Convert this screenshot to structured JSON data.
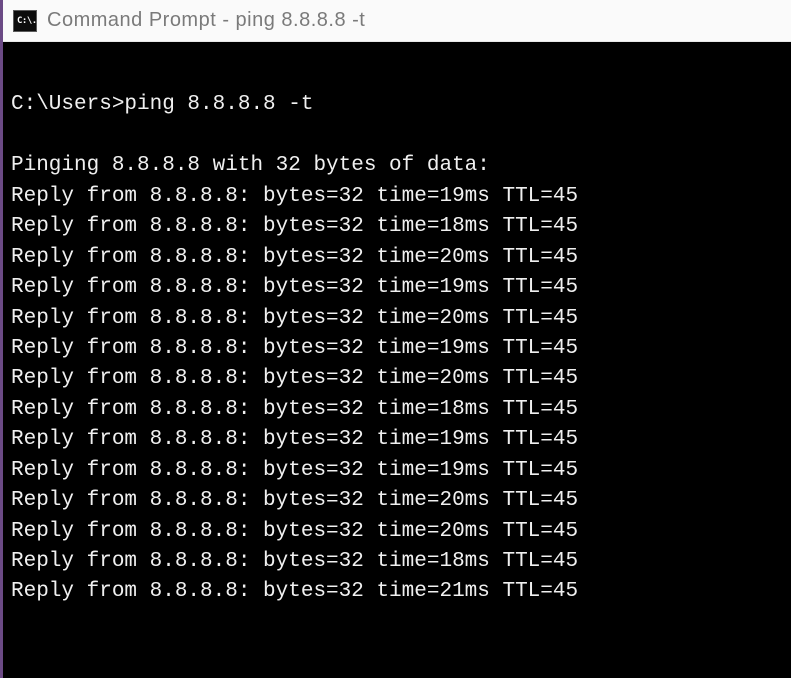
{
  "window": {
    "icon_label": "C:\\.",
    "title": "Command Prompt - ping  8.8.8.8 -t"
  },
  "terminal": {
    "prompt_line": "C:\\Users>ping 8.8.8.8 -t",
    "header_line": "Pinging 8.8.8.8 with 32 bytes of data:",
    "replies": [
      {
        "ip": "8.8.8.8",
        "bytes": 32,
        "time_ms": 19,
        "ttl": 45
      },
      {
        "ip": "8.8.8.8",
        "bytes": 32,
        "time_ms": 18,
        "ttl": 45
      },
      {
        "ip": "8.8.8.8",
        "bytes": 32,
        "time_ms": 20,
        "ttl": 45
      },
      {
        "ip": "8.8.8.8",
        "bytes": 32,
        "time_ms": 19,
        "ttl": 45
      },
      {
        "ip": "8.8.8.8",
        "bytes": 32,
        "time_ms": 20,
        "ttl": 45
      },
      {
        "ip": "8.8.8.8",
        "bytes": 32,
        "time_ms": 19,
        "ttl": 45
      },
      {
        "ip": "8.8.8.8",
        "bytes": 32,
        "time_ms": 20,
        "ttl": 45
      },
      {
        "ip": "8.8.8.8",
        "bytes": 32,
        "time_ms": 18,
        "ttl": 45
      },
      {
        "ip": "8.8.8.8",
        "bytes": 32,
        "time_ms": 19,
        "ttl": 45
      },
      {
        "ip": "8.8.8.8",
        "bytes": 32,
        "time_ms": 19,
        "ttl": 45
      },
      {
        "ip": "8.8.8.8",
        "bytes": 32,
        "time_ms": 20,
        "ttl": 45
      },
      {
        "ip": "8.8.8.8",
        "bytes": 32,
        "time_ms": 20,
        "ttl": 45
      },
      {
        "ip": "8.8.8.8",
        "bytes": 32,
        "time_ms": 18,
        "ttl": 45
      },
      {
        "ip": "8.8.8.8",
        "bytes": 32,
        "time_ms": 21,
        "ttl": 45
      }
    ]
  }
}
